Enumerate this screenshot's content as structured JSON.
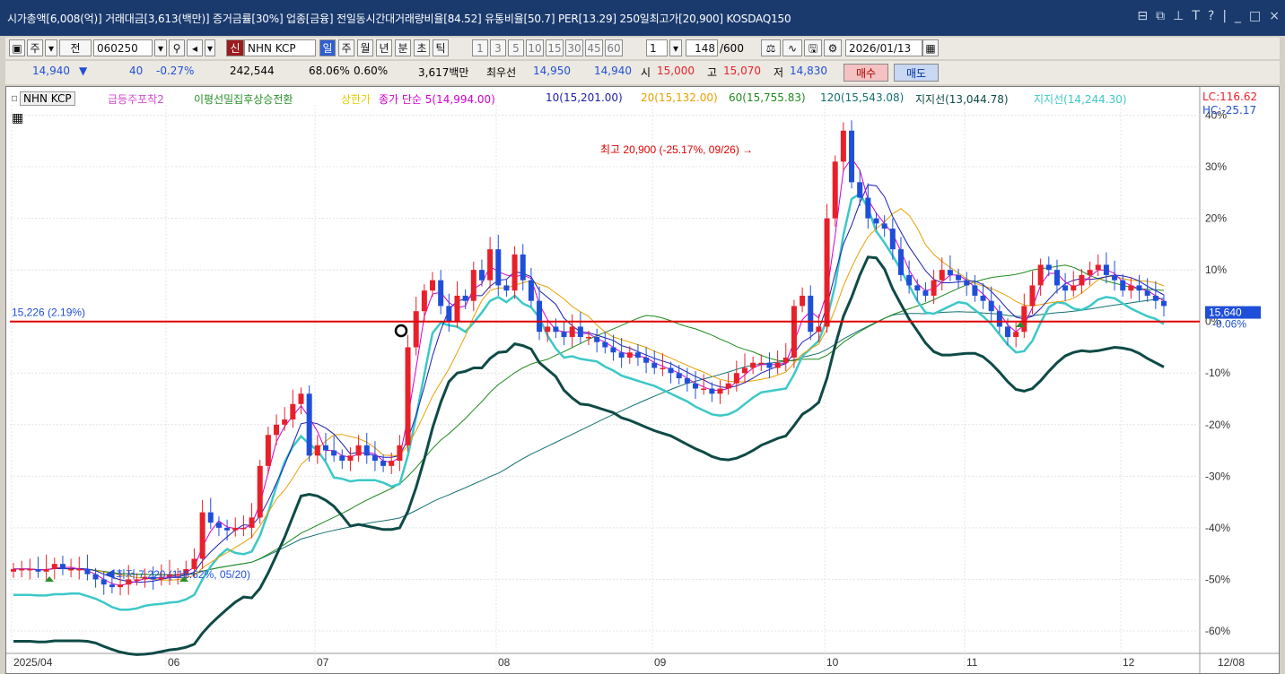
{
  "titlebar": {
    "text": "시가총액[6,008(억)] 거래대금[3,613(백만)] 증거금률[30%] 업종[금융] 전일동시간대거래량비율[84.52] 유통비율[50.7] PER[13.29] 250일최고가[20,900] KOSDAQ150",
    "icons": [
      "restore-icon",
      "popout-icon",
      "pin-icon",
      "font-icon",
      "help-icon",
      "minimize-icon",
      "maximize-icon",
      "close-icon"
    ]
  },
  "toolbar": {
    "mode": "주",
    "view": "전",
    "code": "060250",
    "badge": "신",
    "stock_name": "NHN KCP",
    "periods": [
      "일",
      "주",
      "월",
      "년",
      "분",
      "초",
      "틱"
    ],
    "intervals": [
      "1",
      "3",
      "5",
      "10",
      "15",
      "30",
      "45",
      "60"
    ],
    "count": "1",
    "range": "148",
    "range_total": "/600",
    "date": "2026/01/13"
  },
  "pricebar": {
    "price": "14,940",
    "change_arrow": "▼",
    "change": "40",
    "change_pct": "-0.27%",
    "volume": "242,544",
    "vol_ratio": "68.06%",
    "turnover": "0.60%",
    "amount": "3,617백만",
    "best_label": "최우선",
    "ask": "14,950",
    "bid": "14,940",
    "open_label": "시",
    "open": "15,000",
    "high_label": "고",
    "high": "15,070",
    "low_label": "저",
    "low": "14,830",
    "buy_label": "매수",
    "sell_label": "매도"
  },
  "legend": {
    "stock": "NHN KCP",
    "items": [
      {
        "label": "급등주포착2",
        "color": "#d14ed1"
      },
      {
        "label": "이평선밀집후상승전환",
        "color": "#2a8f2a"
      },
      {
        "label": "상한가",
        "color": "#e0d000"
      },
      {
        "label": "종가 단순 5(14,994.00)",
        "color": "#d000d0"
      },
      {
        "label": "10(15,201.00)",
        "color": "#1c1cb0"
      },
      {
        "label": "20(15,132.00)",
        "color": "#e8a000"
      },
      {
        "label": "60(15,755.83)",
        "color": "#1e8a1e"
      },
      {
        "label": "120(15,543.08)",
        "color": "#137070"
      },
      {
        "label": "지지선(13,044.78)",
        "color": "#0e4a46"
      },
      {
        "label": "지지선(14,244.30)",
        "color": "#3cc8c8"
      }
    ],
    "lc": "LC:116.62",
    "hc": "HC:-25.17"
  },
  "annotations": {
    "high": "최고 20,900 (-25.17%, 09/26)",
    "low": "최저 7,220 (116.62%, 05/20)",
    "ref_line": "15,226 (2.19%)",
    "current_price": "15,640",
    "current_pct": "-0.06%"
  },
  "colors": {
    "up": "#e8202a",
    "down": "#1f4fd8",
    "ref": "#e00000",
    "cyan": "#3cc8c8",
    "dark": "#0e4a46"
  },
  "chart_data": {
    "type": "candlestick",
    "x_labels": [
      "2025/04",
      "06",
      "07",
      "08",
      "09",
      "10",
      "11",
      "12",
      "12/08"
    ],
    "y_ticks": [
      "40%",
      "30%",
      "20%",
      "10%",
      "0%",
      "-10%",
      "-20%",
      "-30%",
      "-40%",
      "-50%",
      "-60%"
    ],
    "ylim_pct": [
      -64,
      42
    ],
    "ref_pct": 0,
    "high_point": {
      "price": 20900,
      "pct": -25.17,
      "date": "09/26"
    },
    "low_point": {
      "price": 7220,
      "pct": 116.62,
      "date": "05/20"
    },
    "price_pct_series": [
      -48,
      -48,
      -48,
      -48.5,
      -48,
      -47,
      -48,
      -48,
      -48,
      -49,
      -50,
      -51,
      -51.5,
      -51,
      -50,
      -50,
      -49.5,
      -50,
      -49.5,
      -49,
      -49,
      -48,
      -46,
      -37,
      -39,
      -40,
      -40.5,
      -40,
      -40,
      -38,
      -28,
      -22,
      -20,
      -19,
      -16,
      -14,
      -26,
      -24,
      -25,
      -26,
      -27,
      -26,
      -24,
      -26,
      -27,
      -28,
      -27,
      -24,
      -5,
      2,
      6,
      8,
      3,
      0,
      5,
      4,
      10,
      8,
      14,
      7,
      6,
      13,
      8,
      4,
      -2,
      -1,
      -2,
      -3,
      -1,
      -3,
      -3,
      -4,
      -5,
      -6,
      -7,
      -6,
      -7,
      -8,
      -9,
      -9,
      -10,
      -11,
      -12,
      -13,
      -13,
      -14,
      -13,
      -12,
      -10,
      -9,
      -8,
      -8,
      -9,
      -8,
      -7,
      3,
      5,
      -2,
      -1,
      20,
      31,
      37,
      27,
      24,
      20,
      19,
      18,
      14,
      9,
      7,
      6,
      5,
      8,
      10,
      9,
      8,
      7,
      5,
      4,
      2,
      -1,
      -3,
      -2,
      3,
      7,
      11,
      10,
      7,
      6,
      7,
      9,
      10,
      11,
      9,
      8,
      6,
      7,
      6,
      5,
      4,
      3
    ]
  }
}
